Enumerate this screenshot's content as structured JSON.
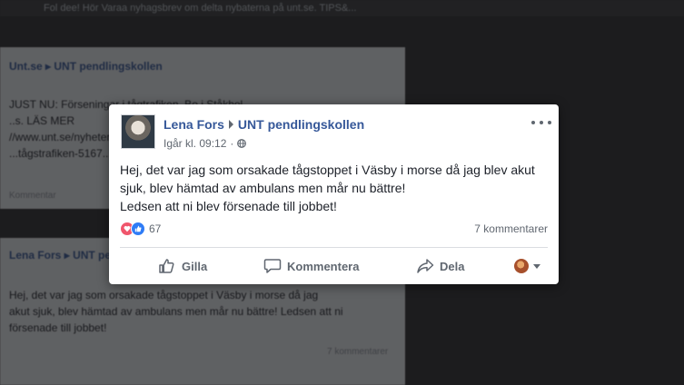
{
  "background": {
    "top_text": "Fol dee! Hör Varaa nyhagsbrev om delta nybaterna på unt.se. TIPS&...",
    "post1": {
      "page": "Unt.se",
      "target": "UNT pendlingskollen",
      "line1": "JUST NU: Förseningar i tågtrafiken. Bo i Ståkhol...",
      "line2": "..s. LÄS MER",
      "line3": "//www.unt.se/nyheter/...",
      "line4": "...tågstrafiken-5167...",
      "footer": "Kommentar"
    },
    "post2": {
      "author": "Lena Fors",
      "target": "UNT pendlingskollen",
      "line1": "Hej, det var jag som orsakade tågstoppet i Väsby i morse då jag",
      "line2": "akut sjuk, blev hämtad av ambulans men mår nu bättre! Ledsen att ni",
      "line3": "försenade till jobbet!",
      "footer": "7 kommentarer"
    }
  },
  "post": {
    "author": "Lena Fors",
    "target_group": "UNT pendlingskollen",
    "timestamp": "Igår kl. 09:12",
    "separator": "·",
    "text_lines": [
      "Hej, det var jag som orsakade tågstoppet i Väsby i morse då jag blev akut",
      "sjuk, blev hämtad av ambulans men mår nu bättre!",
      "Ledsen att ni blev försenade till jobbet!"
    ],
    "reaction_count": "67",
    "comments": "7 kommentarer",
    "actions": {
      "like": "Gilla",
      "comment": "Kommentera",
      "share": "Dela"
    }
  },
  "colors": {
    "link_blue": "#365899",
    "love_red": "#f0566c",
    "like_blue": "#2f7cf6",
    "muted_gray": "#606770"
  },
  "icons": [
    "globe-icon",
    "more-icon",
    "like-icon",
    "comment-icon",
    "share-icon",
    "love-reaction-icon",
    "like-reaction-icon",
    "caret-down-icon"
  ]
}
